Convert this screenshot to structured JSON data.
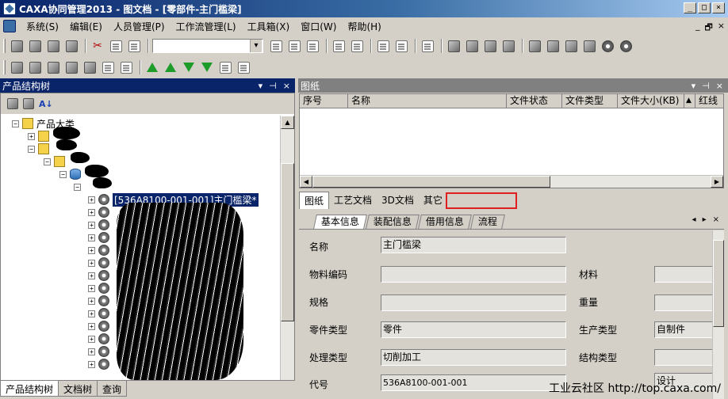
{
  "window": {
    "title": "CAXA协同管理2013 - 图文档 - [零部件-主门槛梁]",
    "buttons": [
      "_",
      "□",
      "×"
    ]
  },
  "menubar": {
    "items": [
      "系统(S)",
      "编辑(E)",
      "人员管理(P)",
      "工作流管理(L)",
      "工具箱(X)",
      "窗口(W)",
      "帮助(H)"
    ],
    "mdi_buttons": [
      "_",
      "ð",
      "×"
    ]
  },
  "toolbar": {
    "combo_value": ""
  },
  "left_panel": {
    "title": "产品结构树",
    "controls": [
      "▾",
      "ꟼ",
      "×"
    ],
    "tree": {
      "root_label": "产品大类",
      "selected_label": "[536A8100-001-001]主门槛梁*"
    },
    "bottom_tabs": [
      "产品结构树",
      "文档树",
      "查询"
    ]
  },
  "right_panel": {
    "title": "图纸",
    "controls": [
      "▾",
      "ꟼ",
      "×"
    ],
    "grid_columns": [
      "序号",
      "名称",
      "文件状态",
      "文件类型",
      "文件大小(KB)",
      "▲",
      "红线"
    ],
    "doc_tabs": [
      "图纸",
      "工艺文档",
      "3D文档",
      "其它"
    ],
    "info_tabs": [
      "基本信息",
      "装配信息",
      "借用信息",
      "流程"
    ],
    "info_nav": [
      "◂",
      "▸",
      "×"
    ],
    "form": {
      "name_label": "名称",
      "name_value": "主门槛梁",
      "material_code_label": "物料编码",
      "material_code_value": "",
      "material_label": "材料",
      "material_value": "",
      "spec_label": "规格",
      "spec_value": "",
      "weight_label": "重量",
      "weight_value": "",
      "part_type_label": "零件类型",
      "part_type_value": "零件",
      "production_type_label": "生产类型",
      "production_type_value": "自制件",
      "process_type_label": "处理类型",
      "process_type_value": "切削加工",
      "structure_type_label": "结构类型",
      "structure_type_value": "",
      "code_label": "代号",
      "code_value": "536A8100-001-001",
      "design_value": "设计"
    }
  },
  "watermark": "工业云社区 http://top.caxa.com/"
}
